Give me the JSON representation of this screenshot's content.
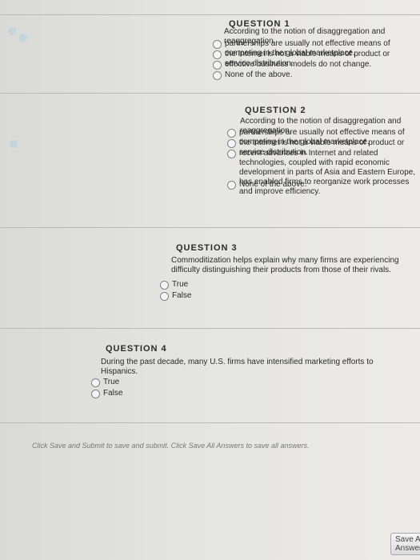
{
  "q1": {
    "title": "QUESTION 1",
    "text": "According to the notion of disaggregation and reaggregation,",
    "options": [
      "partnerships are usually not effective means of competing in the global marketplace.",
      "the Internet is not a viable means of product or service distribution.",
      "effective business models do not change.",
      "None of the above."
    ]
  },
  "q2": {
    "title": "QUESTION 2",
    "text": "According to the notion of disaggregation and reaggregation,",
    "options": [
      "partnerships are usually not effective means of competing in the global marketplace.",
      "the Internet is not a viable means of product or service distribution.",
      "recent advances in Internet and related technologies, coupled with rapid economic development in parts of Asia and Eastern Europe, has enabled firms to reorganize work processes and improve efficiency.",
      "None of the above."
    ]
  },
  "q3": {
    "title": "QUESTION 3",
    "text": "Commoditization helps explain why many firms are experiencing difficulty distinguishing their products from those of their rivals.",
    "options": [
      "True",
      "False"
    ]
  },
  "q4": {
    "title": "QUESTION 4",
    "text": "During the past decade, many U.S. firms have intensified marketing efforts to Hispanics.",
    "options": [
      "True",
      "False"
    ]
  },
  "footer": {
    "note": "Click Save and Submit to save and submit. Click Save All Answers to save all answers.",
    "save_all": "Save All Answers"
  }
}
